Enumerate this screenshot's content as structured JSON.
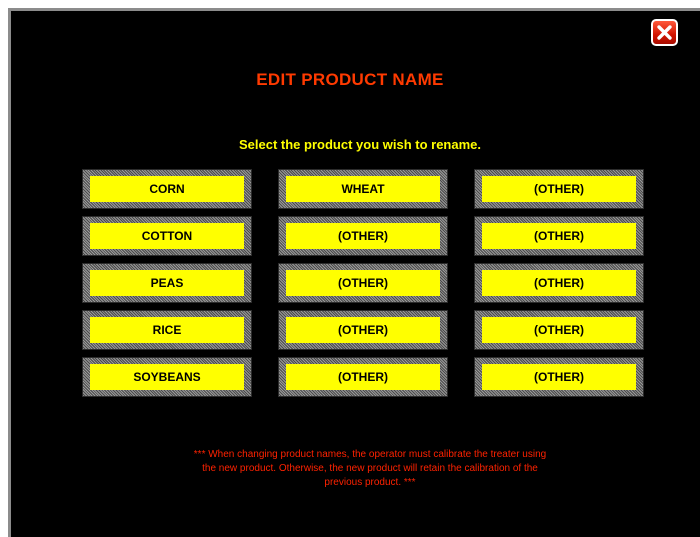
{
  "dialog": {
    "title": "EDIT PRODUCT NAME",
    "instruction": "Select the product you wish to rename.",
    "notice_line1": "*** When changing product names, the operator must calibrate the treater using",
    "notice_line2": "the new product.  Otherwise, the new product will retain the calibration of the",
    "notice_line3": "previous product. ***"
  },
  "products": {
    "col1": [
      "CORN",
      "COTTON",
      "PEAS",
      "RICE",
      "SOYBEANS"
    ],
    "col2": [
      "WHEAT",
      "(OTHER)",
      "(OTHER)",
      "(OTHER)",
      "(OTHER)"
    ],
    "col3": [
      "(OTHER)",
      "(OTHER)",
      "(OTHER)",
      "(OTHER)",
      "(OTHER)"
    ]
  },
  "icons": {
    "close": "close-icon"
  },
  "colors": {
    "background": "#000000",
    "title": "#ff3a00",
    "instruction": "#ffff00",
    "button_face": "#ffff00",
    "notice": "#ff2200",
    "close_button": "#d21400"
  }
}
